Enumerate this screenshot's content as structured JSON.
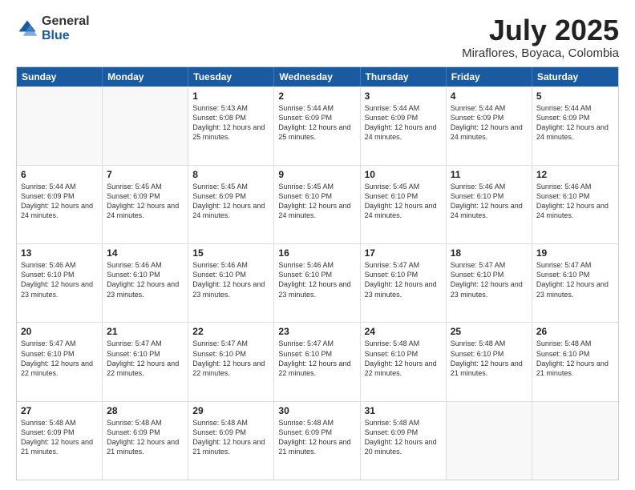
{
  "logo": {
    "general": "General",
    "blue": "Blue"
  },
  "title": "July 2025",
  "location": "Miraflores, Boyaca, Colombia",
  "header_days": [
    "Sunday",
    "Monday",
    "Tuesday",
    "Wednesday",
    "Thursday",
    "Friday",
    "Saturday"
  ],
  "weeks": [
    [
      {
        "day": "",
        "info": ""
      },
      {
        "day": "",
        "info": ""
      },
      {
        "day": "1",
        "info": "Sunrise: 5:43 AM\nSunset: 6:08 PM\nDaylight: 12 hours and 25 minutes."
      },
      {
        "day": "2",
        "info": "Sunrise: 5:44 AM\nSunset: 6:09 PM\nDaylight: 12 hours and 25 minutes."
      },
      {
        "day": "3",
        "info": "Sunrise: 5:44 AM\nSunset: 6:09 PM\nDaylight: 12 hours and 24 minutes."
      },
      {
        "day": "4",
        "info": "Sunrise: 5:44 AM\nSunset: 6:09 PM\nDaylight: 12 hours and 24 minutes."
      },
      {
        "day": "5",
        "info": "Sunrise: 5:44 AM\nSunset: 6:09 PM\nDaylight: 12 hours and 24 minutes."
      }
    ],
    [
      {
        "day": "6",
        "info": "Sunrise: 5:44 AM\nSunset: 6:09 PM\nDaylight: 12 hours and 24 minutes."
      },
      {
        "day": "7",
        "info": "Sunrise: 5:45 AM\nSunset: 6:09 PM\nDaylight: 12 hours and 24 minutes."
      },
      {
        "day": "8",
        "info": "Sunrise: 5:45 AM\nSunset: 6:09 PM\nDaylight: 12 hours and 24 minutes."
      },
      {
        "day": "9",
        "info": "Sunrise: 5:45 AM\nSunset: 6:10 PM\nDaylight: 12 hours and 24 minutes."
      },
      {
        "day": "10",
        "info": "Sunrise: 5:45 AM\nSunset: 6:10 PM\nDaylight: 12 hours and 24 minutes."
      },
      {
        "day": "11",
        "info": "Sunrise: 5:46 AM\nSunset: 6:10 PM\nDaylight: 12 hours and 24 minutes."
      },
      {
        "day": "12",
        "info": "Sunrise: 5:46 AM\nSunset: 6:10 PM\nDaylight: 12 hours and 24 minutes."
      }
    ],
    [
      {
        "day": "13",
        "info": "Sunrise: 5:46 AM\nSunset: 6:10 PM\nDaylight: 12 hours and 23 minutes."
      },
      {
        "day": "14",
        "info": "Sunrise: 5:46 AM\nSunset: 6:10 PM\nDaylight: 12 hours and 23 minutes."
      },
      {
        "day": "15",
        "info": "Sunrise: 5:46 AM\nSunset: 6:10 PM\nDaylight: 12 hours and 23 minutes."
      },
      {
        "day": "16",
        "info": "Sunrise: 5:46 AM\nSunset: 6:10 PM\nDaylight: 12 hours and 23 minutes."
      },
      {
        "day": "17",
        "info": "Sunrise: 5:47 AM\nSunset: 6:10 PM\nDaylight: 12 hours and 23 minutes."
      },
      {
        "day": "18",
        "info": "Sunrise: 5:47 AM\nSunset: 6:10 PM\nDaylight: 12 hours and 23 minutes."
      },
      {
        "day": "19",
        "info": "Sunrise: 5:47 AM\nSunset: 6:10 PM\nDaylight: 12 hours and 23 minutes."
      }
    ],
    [
      {
        "day": "20",
        "info": "Sunrise: 5:47 AM\nSunset: 6:10 PM\nDaylight: 12 hours and 22 minutes."
      },
      {
        "day": "21",
        "info": "Sunrise: 5:47 AM\nSunset: 6:10 PM\nDaylight: 12 hours and 22 minutes."
      },
      {
        "day": "22",
        "info": "Sunrise: 5:47 AM\nSunset: 6:10 PM\nDaylight: 12 hours and 22 minutes."
      },
      {
        "day": "23",
        "info": "Sunrise: 5:47 AM\nSunset: 6:10 PM\nDaylight: 12 hours and 22 minutes."
      },
      {
        "day": "24",
        "info": "Sunrise: 5:48 AM\nSunset: 6:10 PM\nDaylight: 12 hours and 22 minutes."
      },
      {
        "day": "25",
        "info": "Sunrise: 5:48 AM\nSunset: 6:10 PM\nDaylight: 12 hours and 21 minutes."
      },
      {
        "day": "26",
        "info": "Sunrise: 5:48 AM\nSunset: 6:10 PM\nDaylight: 12 hours and 21 minutes."
      }
    ],
    [
      {
        "day": "27",
        "info": "Sunrise: 5:48 AM\nSunset: 6:09 PM\nDaylight: 12 hours and 21 minutes."
      },
      {
        "day": "28",
        "info": "Sunrise: 5:48 AM\nSunset: 6:09 PM\nDaylight: 12 hours and 21 minutes."
      },
      {
        "day": "29",
        "info": "Sunrise: 5:48 AM\nSunset: 6:09 PM\nDaylight: 12 hours and 21 minutes."
      },
      {
        "day": "30",
        "info": "Sunrise: 5:48 AM\nSunset: 6:09 PM\nDaylight: 12 hours and 21 minutes."
      },
      {
        "day": "31",
        "info": "Sunrise: 5:48 AM\nSunset: 6:09 PM\nDaylight: 12 hours and 20 minutes."
      },
      {
        "day": "",
        "info": ""
      },
      {
        "day": "",
        "info": ""
      }
    ]
  ]
}
